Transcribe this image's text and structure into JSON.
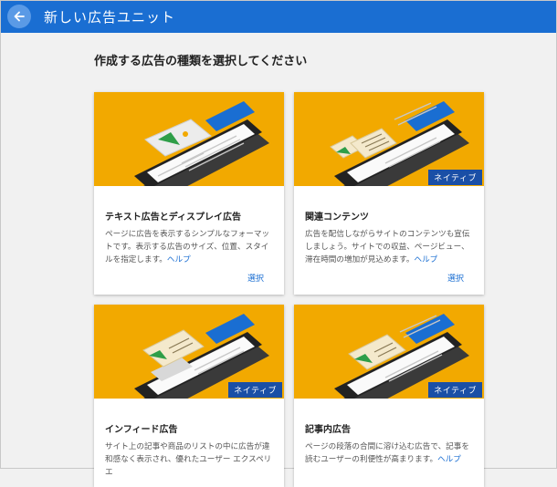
{
  "header": {
    "title": "新しい広告ユニット"
  },
  "page": {
    "heading": "作成する広告の種類を選択してください"
  },
  "cards": [
    {
      "title": "テキスト広告とディスプレイ広告",
      "badge": "",
      "description": "ページに広告を表示するシンプルなフォーマットです。表示する広告のサイズ、位置、スタイルを指定します。",
      "help": "ヘルプ",
      "select": "選択"
    },
    {
      "title": "関連コンテンツ",
      "badge": "ネイティブ",
      "description": "広告を配信しながらサイトのコンテンツも宣伝しましょう。サイトでの収益、ページビュー、滞在時間の増加が見込めます。",
      "help": "ヘルプ",
      "select": "選択"
    },
    {
      "title": "インフィード広告",
      "badge": "ネイティブ",
      "description": "サイト上の記事や商品のリストの中に広告が違和感なく表示され、優れたユーザー エクスペリエ",
      "help": "",
      "select": ""
    },
    {
      "title": "記事内広告",
      "badge": "ネイティブ",
      "description": "ページの段落の合間に溶け込む広告で、記事を読むユーザーの利便性が高まります。",
      "help": "ヘルプ",
      "select": ""
    }
  ]
}
